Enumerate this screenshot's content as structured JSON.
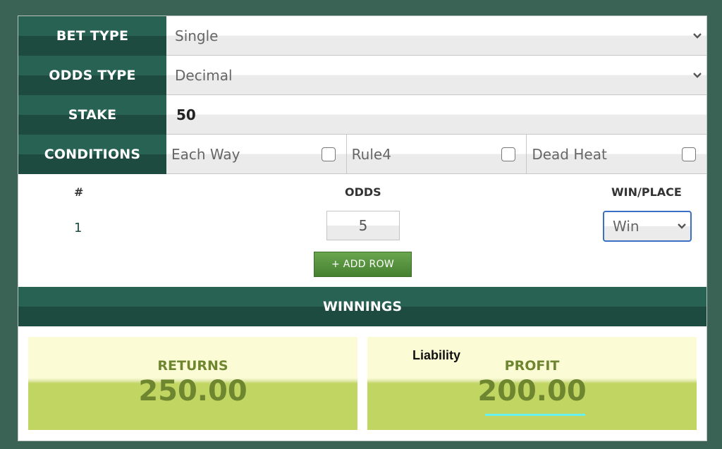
{
  "form": {
    "bet_type": {
      "label": "BET TYPE",
      "value": "Single"
    },
    "odds_type": {
      "label": "ODDS TYPE",
      "value": "Decimal"
    },
    "stake": {
      "label": "STAKE",
      "value": "50"
    },
    "conditions": {
      "label": "CONDITIONS",
      "options": [
        {
          "label": "Each Way",
          "checked": false
        },
        {
          "label": "Rule4",
          "checked": false
        },
        {
          "label": "Dead Heat",
          "checked": false
        }
      ]
    }
  },
  "selections": {
    "headers": {
      "num": "#",
      "odds": "ODDS",
      "win_place": "WIN/PLACE"
    },
    "rows": [
      {
        "num": "1",
        "odds": "5",
        "win_place": "Win"
      }
    ],
    "add_row_label": "+ ADD ROW"
  },
  "winnings": {
    "title": "WINNINGS",
    "returns": {
      "label": "RETURNS",
      "value": "250.00"
    },
    "profit": {
      "label": "PROFIT",
      "value": "200.00",
      "note": "Liability"
    }
  }
}
